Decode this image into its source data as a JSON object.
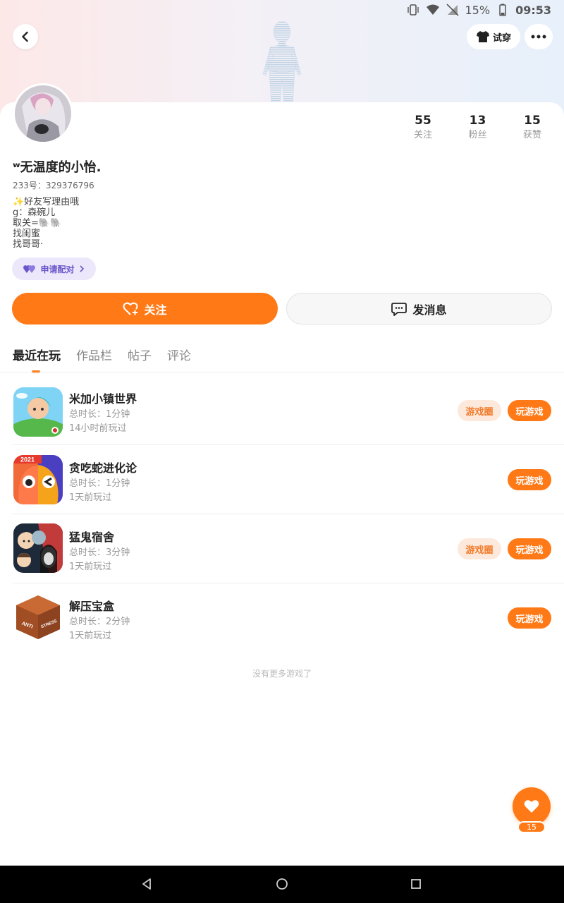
{
  "status_bar": {
    "battery": "15%",
    "time": "09:53"
  },
  "header": {
    "tryon_label": "试穿"
  },
  "profile": {
    "stats": [
      {
        "value": "55",
        "label": "关注"
      },
      {
        "value": "13",
        "label": "粉丝"
      },
      {
        "value": "15",
        "label": "获赞"
      }
    ],
    "nickname": "ʷ无温度的小怡.",
    "uid": "233号：329376796",
    "bio": [
      "✨好友写理由哦",
      "g：森碗儿",
      "取关=🐘🐘",
      "找闺蜜",
      "找哥哥·"
    ],
    "pair_label": "申请配对",
    "follow_label": "关注",
    "message_label": "发消息"
  },
  "tabs": [
    {
      "label": "最近在玩",
      "active": true
    },
    {
      "label": "作品栏",
      "active": false
    },
    {
      "label": "帖子",
      "active": false
    },
    {
      "label": "评论",
      "active": false
    }
  ],
  "games": [
    {
      "name": "米加小镇世界",
      "duration": "总时长：1分钟",
      "last_played": "14小时前玩过",
      "circle": "游戏圈",
      "play": "玩游戏"
    },
    {
      "name": "贪吃蛇进化论",
      "duration": "总时长：1分钟",
      "last_played": "1天前玩过",
      "circle": "",
      "play": "玩游戏",
      "badge": "2021"
    },
    {
      "name": "猛鬼宿舍",
      "duration": "总时长：3分钟",
      "last_played": "1天前玩过",
      "circle": "游戏圈",
      "play": "玩游戏"
    },
    {
      "name": "解压宝盒",
      "duration": "总时长：2分钟",
      "last_played": "1天前玩过",
      "circle": "",
      "play": "玩游戏",
      "badge_left": "ANTI",
      "badge_right": "STRESS"
    }
  ],
  "no_more_text": "没有更多游戏了",
  "like_count": "15",
  "colors": {
    "accent": "#ff7a17",
    "pair_purple": "#6b55c9"
  }
}
